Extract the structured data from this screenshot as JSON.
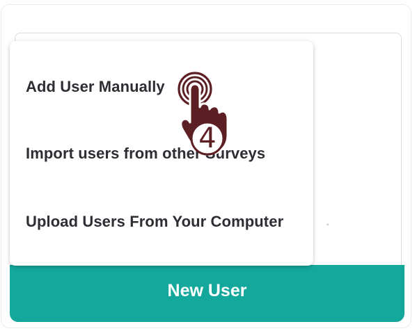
{
  "dropdown": {
    "items": [
      {
        "label": "Add User Manually"
      },
      {
        "label": "Import users from other Surveys"
      },
      {
        "label": "Upload Users From Your Computer"
      }
    ]
  },
  "new_user_button": {
    "label": "New User"
  },
  "step_indicator": {
    "number": "4"
  },
  "colors": {
    "accent": "#14a89c",
    "pointer": "#5c1f24",
    "menu_text": "#2d2d33"
  },
  "icons": {
    "pointer": "hand-pointer-icon"
  }
}
